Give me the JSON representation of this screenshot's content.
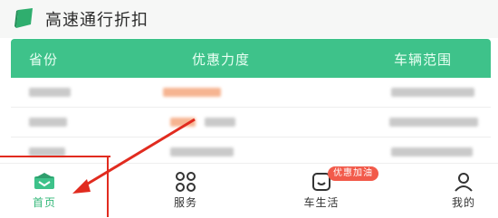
{
  "header": {
    "title": "高速通行折扣"
  },
  "table": {
    "columns": [
      "省份",
      "优惠力度",
      "车辆范围"
    ]
  },
  "tabbar": {
    "items": [
      {
        "label": "首页",
        "icon": "home-icon",
        "active": true
      },
      {
        "label": "服务",
        "icon": "grid-icon",
        "active": false
      },
      {
        "label": "车生活",
        "icon": "car-life-icon",
        "active": false
      },
      {
        "label": "我的",
        "icon": "user-icon",
        "active": false
      }
    ],
    "badge": "优惠加油"
  },
  "colors": {
    "accent": "#3ec28a",
    "annotation": "#e12b1f",
    "badge": "#f25a4a"
  }
}
